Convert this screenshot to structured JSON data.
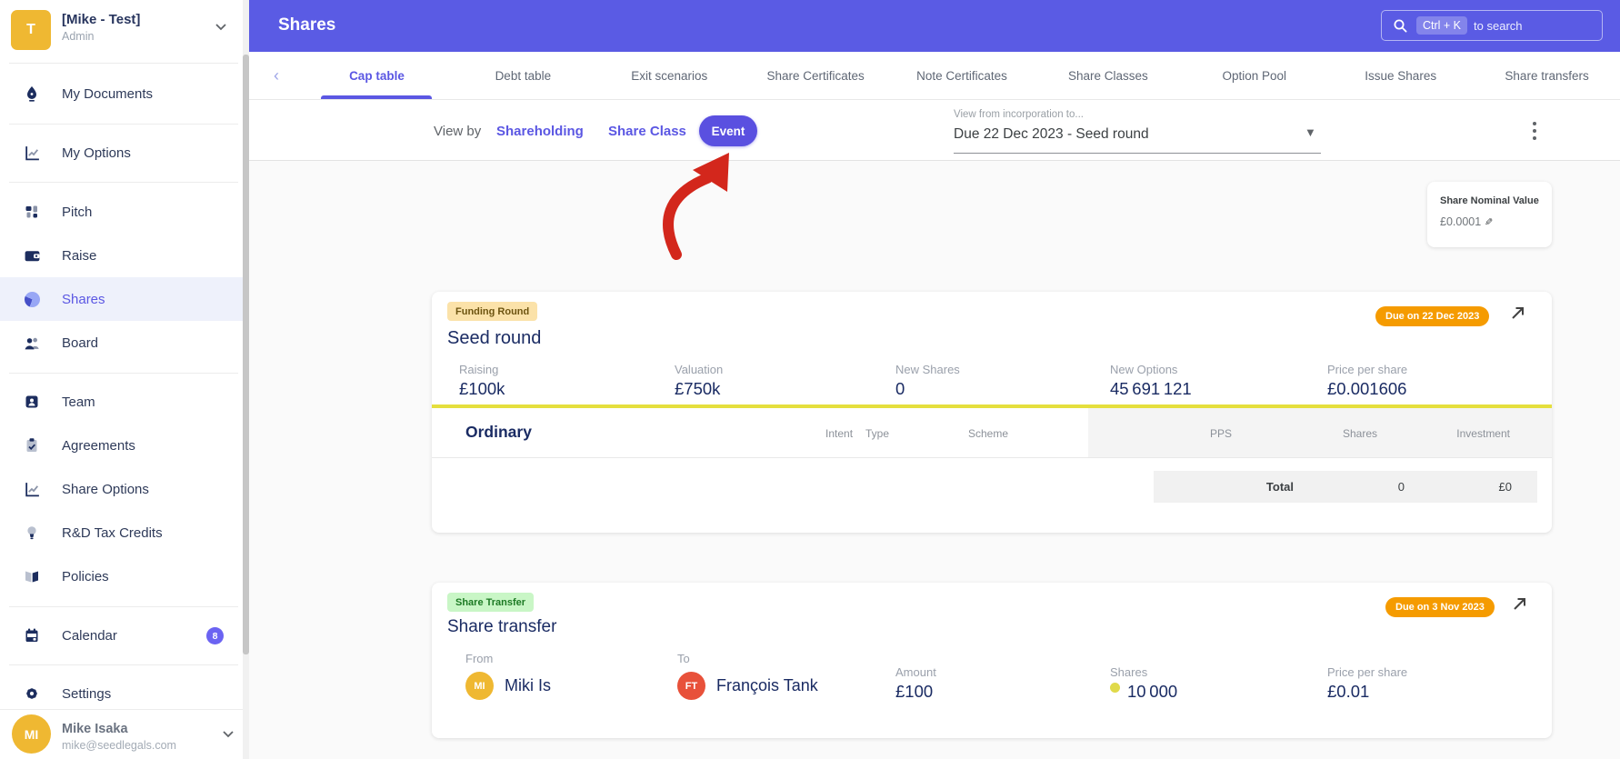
{
  "sidebar": {
    "workspace": {
      "initial": "T",
      "name": "[Mike - Test]",
      "role": "Admin"
    },
    "items": [
      {
        "label": "My Documents",
        "icon": "pen-nib"
      },
      {
        "label": "My Options",
        "icon": "line-chart"
      },
      {
        "label": "Pitch",
        "icon": "layout"
      },
      {
        "label": "Raise",
        "icon": "wallet"
      },
      {
        "label": "Shares",
        "icon": "pie-chart"
      },
      {
        "label": "Board",
        "icon": "people"
      },
      {
        "label": "Team",
        "icon": "person-badge"
      },
      {
        "label": "Agreements",
        "icon": "clipboard-check"
      },
      {
        "label": "Share Options",
        "icon": "line-chart"
      },
      {
        "label": "R&D Tax Credits",
        "icon": "lightbulb"
      },
      {
        "label": "Policies",
        "icon": "book"
      },
      {
        "label": "Calendar",
        "icon": "calendar",
        "badge": "8"
      },
      {
        "label": "Settings",
        "icon": "gear"
      }
    ],
    "user": {
      "initials": "MI",
      "name": "Mike Isaka",
      "email": "mike@seedlegals.com"
    }
  },
  "header": {
    "title": "Shares",
    "search_shortcut": "Ctrl + K",
    "search_hint": "to search"
  },
  "tabs": {
    "active": "Cap table",
    "items": [
      {
        "label": "Cap table"
      },
      {
        "label": "Debt table"
      },
      {
        "label": "Exit scenarios"
      },
      {
        "label": "Share Certificates"
      },
      {
        "label": "Note Certificates"
      },
      {
        "label": "Share Classes"
      },
      {
        "label": "Option Pool"
      },
      {
        "label": "Issue Shares"
      },
      {
        "label": "Share transfers"
      }
    ]
  },
  "filterbar": {
    "view_by_label": "View by",
    "option_shareholding": "Shareholding",
    "option_share_class": "Share Class",
    "option_event": "Event",
    "active_option": "Event",
    "range_label": "View from incorporation to...",
    "range_value": "Due 22 Dec 2023 - Seed round"
  },
  "nominal_card": {
    "title": "Share Nominal Value",
    "value": "£0.0001"
  },
  "cards": [
    {
      "badge": "Funding Round",
      "title": "Seed round",
      "due": "Due on 22 Dec 2023",
      "stats": [
        {
          "label": "Raising",
          "value": "£100k"
        },
        {
          "label": "Valuation",
          "value": "£750k"
        },
        {
          "label": "New Shares",
          "value": "0"
        },
        {
          "label": "New Options",
          "value": "45 691 121"
        },
        {
          "label": "Price per share",
          "value": "£0.001606"
        }
      ],
      "table": {
        "share_class": "Ordinary",
        "col_intent": "Intent",
        "col_type": "Type",
        "col_scheme": "Scheme",
        "col_pps": "PPS",
        "col_shares": "Shares",
        "col_investment": "Investment",
        "total_label": "Total",
        "total_shares": "0",
        "total_investment": "£0"
      }
    },
    {
      "badge": "Share Transfer",
      "title": "Share transfer",
      "due": "Due on 3 Nov 2023",
      "from_label": "From",
      "from_initials": "MI",
      "from_name": "Miki Is",
      "to_label": "To",
      "to_initials": "FT",
      "to_name": "François Tank",
      "amount_label": "Amount",
      "amount_value": "£100",
      "shares_label": "Shares",
      "shares_value": "10 000",
      "pps_label": "Price per share",
      "pps_value": "£0.01"
    }
  ],
  "colors": {
    "accent_purple": "#5b57e3",
    "header_purple": "#5a5be4",
    "due_badge_orange": "#f59b00",
    "share_class_yellow": "#e5df3d",
    "annotation_arrow_red": "#d3271c",
    "avatar_amber": "#efb832",
    "avatar_red": "#e8513a"
  }
}
